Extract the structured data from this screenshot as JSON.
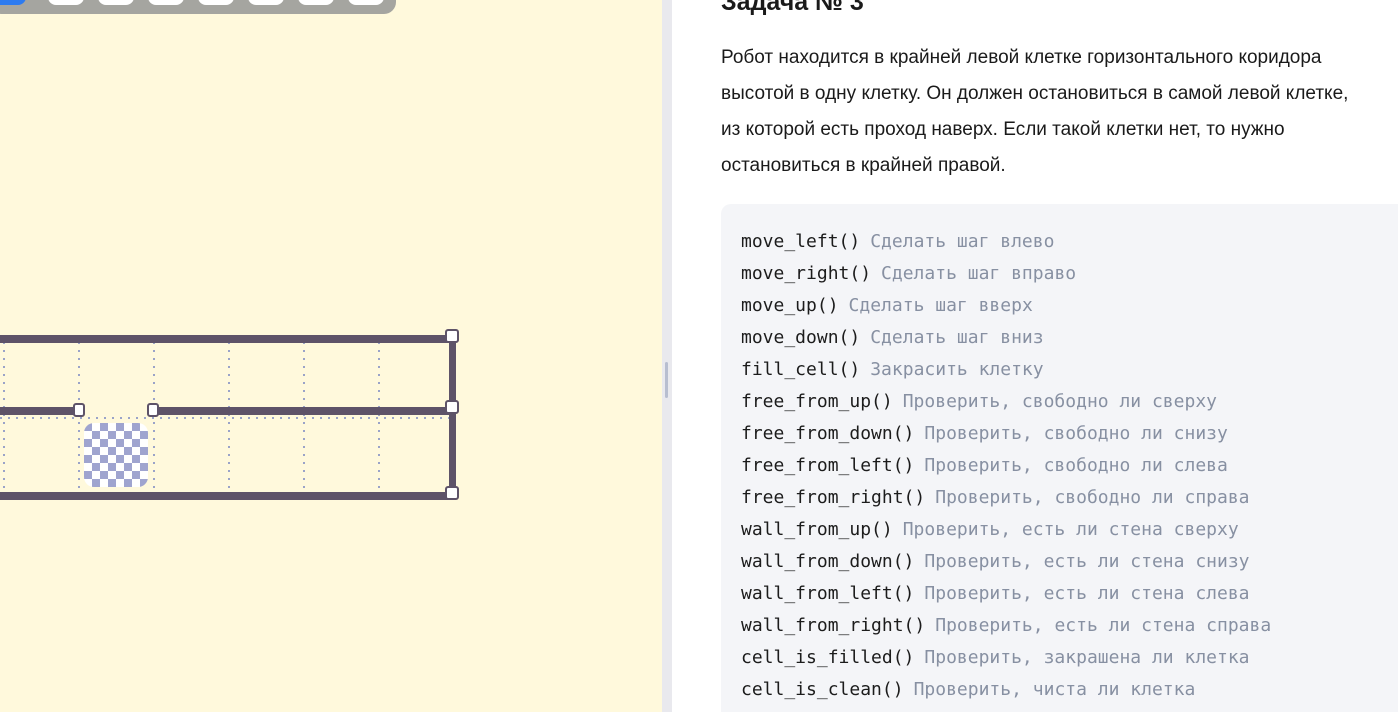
{
  "task": {
    "title": "Задача № 3",
    "description_lines": [
      "Робот находится в крайней левой клетке горизонтального коридора",
      "высотой в одну клетку. Он должен остановиться в самой левой клетке,",
      "из которой есть проход наверх. Если такой клетки нет, то нужно",
      "остановиться в крайней правой."
    ]
  },
  "api": [
    {
      "fn": "move_left()",
      "desc": "Сделать шаг влево"
    },
    {
      "fn": "move_right()",
      "desc": "Сделать шаг вправо"
    },
    {
      "fn": "move_up()",
      "desc": "Сделать шаг вверх"
    },
    {
      "fn": "move_down()",
      "desc": "Сделать шаг вниз"
    },
    {
      "fn": "fill_cell()",
      "desc": "Закрасить клетку"
    },
    {
      "fn": "free_from_up()",
      "desc": "Проверить, свободно ли сверху"
    },
    {
      "fn": "free_from_down()",
      "desc": "Проверить, свободно ли снизу"
    },
    {
      "fn": "free_from_left()",
      "desc": "Проверить, свободно ли слева"
    },
    {
      "fn": "free_from_right()",
      "desc": "Проверить, свободно ли справа"
    },
    {
      "fn": "wall_from_up()",
      "desc": "Проверить, есть ли стена сверху"
    },
    {
      "fn": "wall_from_down()",
      "desc": "Проверить, есть ли стена снизу"
    },
    {
      "fn": "wall_from_left()",
      "desc": "Проверить, есть ли стена слева"
    },
    {
      "fn": "wall_from_right()",
      "desc": "Проверить, есть ли стена справа"
    },
    {
      "fn": "cell_is_filled()",
      "desc": "Проверить, закрашена ли клетка"
    },
    {
      "fn": "cell_is_clean()",
      "desc": "Проверить, чиста ли клетка"
    }
  ],
  "board": {
    "finish_icon": "checkered-flag-icon",
    "colors": {
      "background": "#fff9dc",
      "wall": "#5e5368",
      "grid": "#9aa3c8",
      "finish_dark": "#9fa4cf",
      "finish_light": "#ffffff"
    }
  },
  "toolbar": {
    "active_color": "#2d7bf0"
  }
}
